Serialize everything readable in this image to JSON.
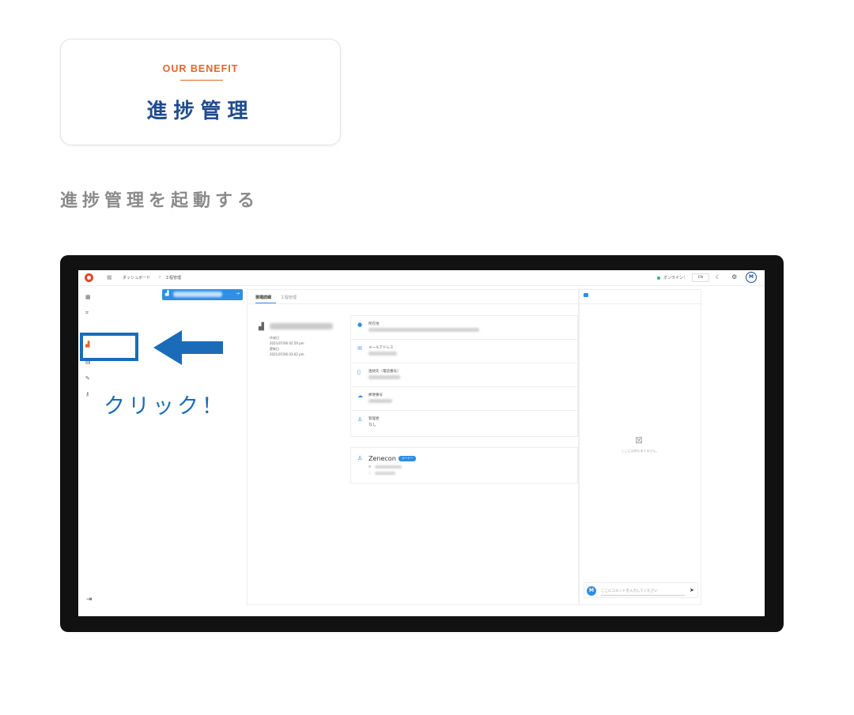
{
  "benefit": {
    "eyebrow": "OUR BENEFIT",
    "title": "進捗管理"
  },
  "section": {
    "heading": "進捗管理を起動する"
  },
  "app": {
    "breadcrumb": [
      "ダッシュボード",
      "工程管理"
    ],
    "breadcrumb_sep": ">",
    "status": "オンライン",
    "status_sep": "|",
    "language": "EN",
    "avatar_initial": "M",
    "tabs": [
      "現場詳細",
      "工程管理"
    ],
    "site": {
      "meta": [
        "作成日",
        "2021/07/06 02:59 pm",
        "更新日",
        "2021/07/06 03:02 pm"
      ]
    },
    "info_labels": [
      "所在地",
      "メールアドレス",
      "連絡先（電話番号）",
      "郵便番号",
      "管理者"
    ],
    "manager_value": "なし",
    "contact": {
      "name": "Zenecon",
      "badge": "オーナー"
    },
    "comments": {
      "empty_text": "ここには何もありません。",
      "placeholder": "ここにコメントを入力してください",
      "avatar_initial": "M"
    }
  },
  "annotation": {
    "click_label": "クリック！",
    "colors": {
      "accent": "#1a6cb8",
      "brand": "#e2672b",
      "title": "#1f4b8e"
    }
  },
  "icons": [
    "dashboard-icon",
    "scan-icon",
    "chart-icon",
    "document-icon",
    "pen-icon",
    "key-icon",
    "logout-icon",
    "settings-icon",
    "moon-icon",
    "send-icon"
  ]
}
